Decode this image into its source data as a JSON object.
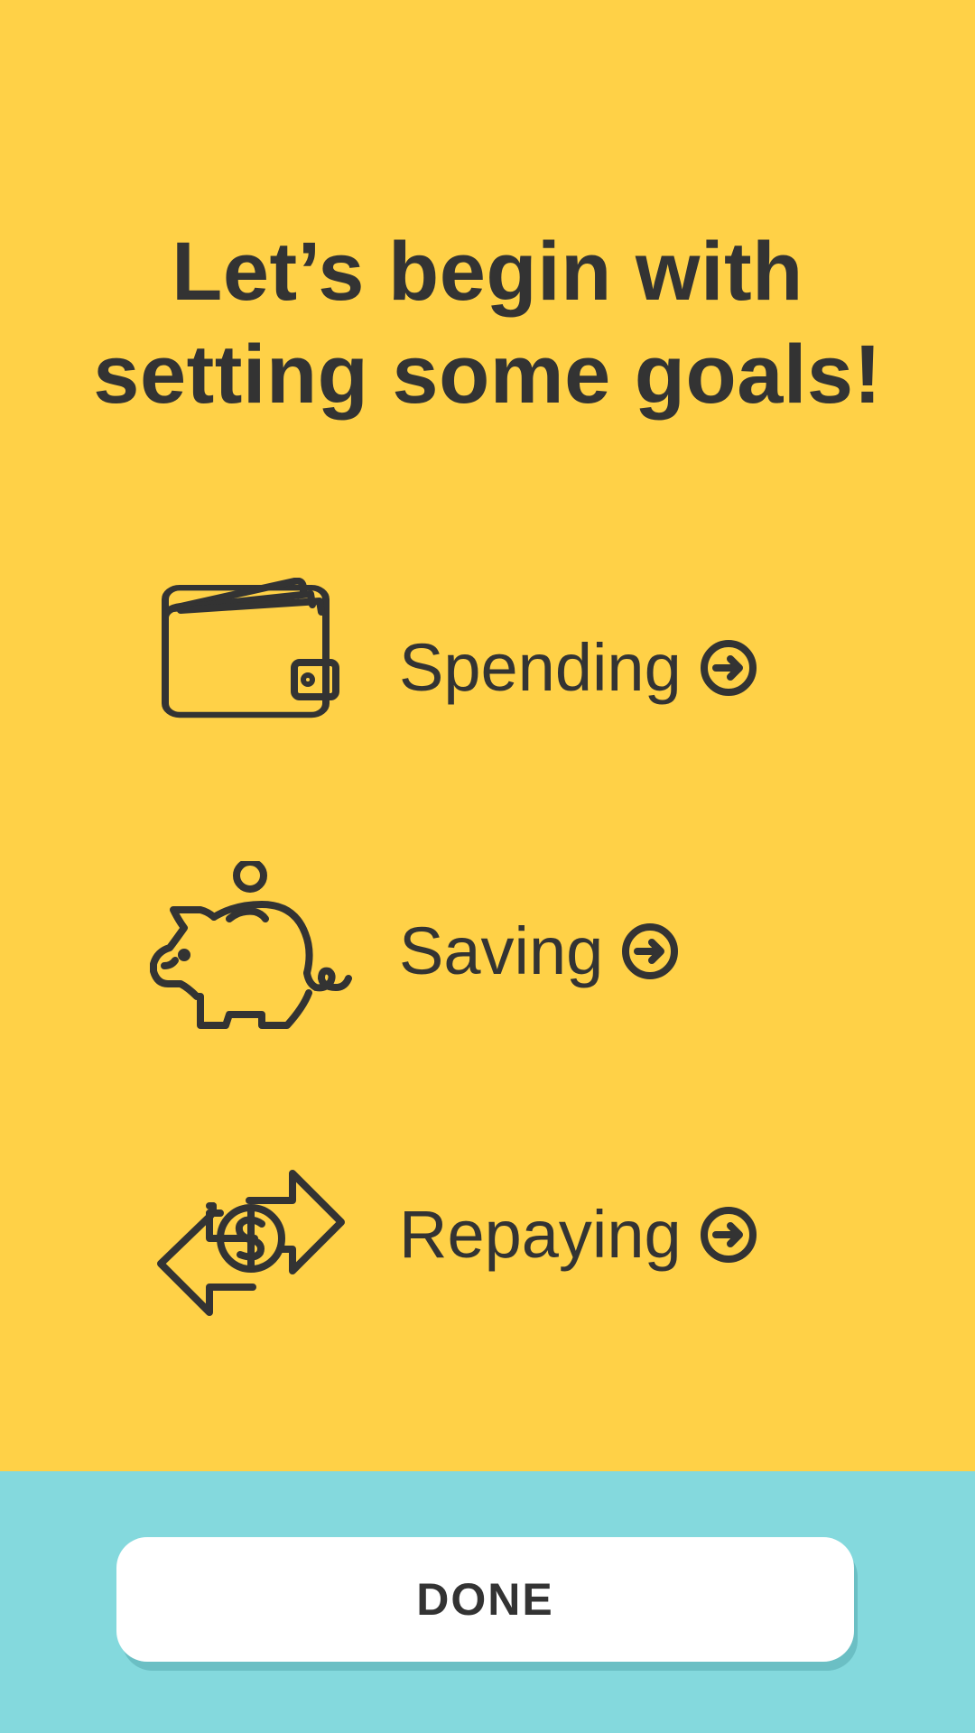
{
  "title": {
    "line1": "Let’s begin with",
    "line2": "setting some goals!"
  },
  "goals": [
    {
      "label": "Spending",
      "icon": "wallet-icon",
      "action_icon": "arrow-circle-right-icon"
    },
    {
      "label": "Saving",
      "icon": "piggy-bank-icon",
      "action_icon": "arrow-circle-right-icon"
    },
    {
      "label": "Repaying",
      "icon": "money-exchange-icon",
      "action_icon": "arrow-circle-right-icon"
    }
  ],
  "done_button": {
    "label": "DONE"
  },
  "colors": {
    "background": "#FFD147",
    "footer": "#84D9DD",
    "text": "#333333",
    "button": "#FFFFFF"
  }
}
